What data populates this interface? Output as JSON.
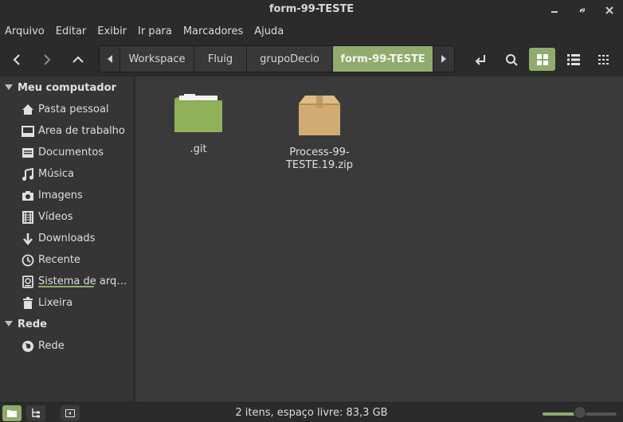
{
  "window": {
    "title": "form-99-TESTE"
  },
  "menu": [
    "Arquivo",
    "Editar",
    "Exibir",
    "Ir para",
    "Marcadores",
    "Ajuda"
  ],
  "breadcrumbs": [
    {
      "label": "Workspace",
      "active": false
    },
    {
      "label": "Fluig",
      "active": false
    },
    {
      "label": "grupoDecio",
      "active": false
    },
    {
      "label": "form-99-TESTE",
      "active": true
    }
  ],
  "sidebar": {
    "sections": [
      {
        "title": "Meu computador"
      },
      {
        "title": "Rede"
      }
    ],
    "computer_items": [
      {
        "label": "Pasta pessoal",
        "icon": "home-icon"
      },
      {
        "label": "Área de trabalho",
        "icon": "desktop-icon"
      },
      {
        "label": "Documentos",
        "icon": "documents-icon"
      },
      {
        "label": "Música",
        "icon": "music-icon"
      },
      {
        "label": "Imagens",
        "icon": "camera-icon"
      },
      {
        "label": "Vídeos",
        "icon": "film-icon"
      },
      {
        "label": "Downloads",
        "icon": "download-icon"
      },
      {
        "label": "Recente",
        "icon": "clock-icon"
      },
      {
        "label": "Sistema de arquivos",
        "icon": "drive-icon"
      },
      {
        "label": "Lixeira",
        "icon": "trash-icon"
      }
    ],
    "network_items": [
      {
        "label": "Rede",
        "icon": "globe-icon"
      }
    ]
  },
  "files": [
    {
      "name": ".git",
      "type": "folder"
    },
    {
      "name": "Process-99-TESTE.19.zip",
      "type": "archive"
    }
  ],
  "status": {
    "text": "2 itens, espaço livre: 83,3 GB",
    "zoom_fraction": 0.5
  },
  "colors": {
    "accent": "#8fac6c",
    "folder": "#8aab55",
    "archive": "#d0ac73"
  }
}
